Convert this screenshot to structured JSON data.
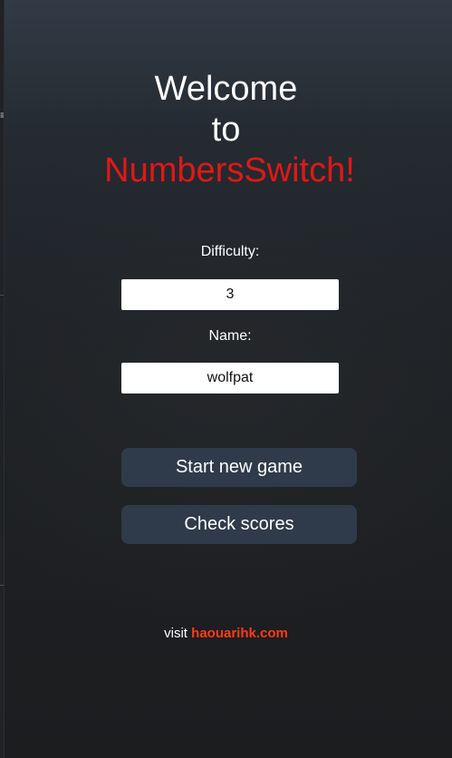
{
  "title": {
    "line1": "Welcome",
    "line2": "to",
    "brand": "NumbersSwitch!"
  },
  "form": {
    "difficulty_label": "Difficulty:",
    "difficulty_value": "3",
    "name_label": "Name:",
    "name_value": "wolfpat"
  },
  "buttons": {
    "start_label": "Start new game",
    "scores_label": "Check scores"
  },
  "footer": {
    "prefix": "visit",
    "link_text": "haouarihk.com"
  },
  "colors": {
    "brand": "#e01818",
    "link": "#ff3b14",
    "button_bg": "#2f3b4a"
  }
}
